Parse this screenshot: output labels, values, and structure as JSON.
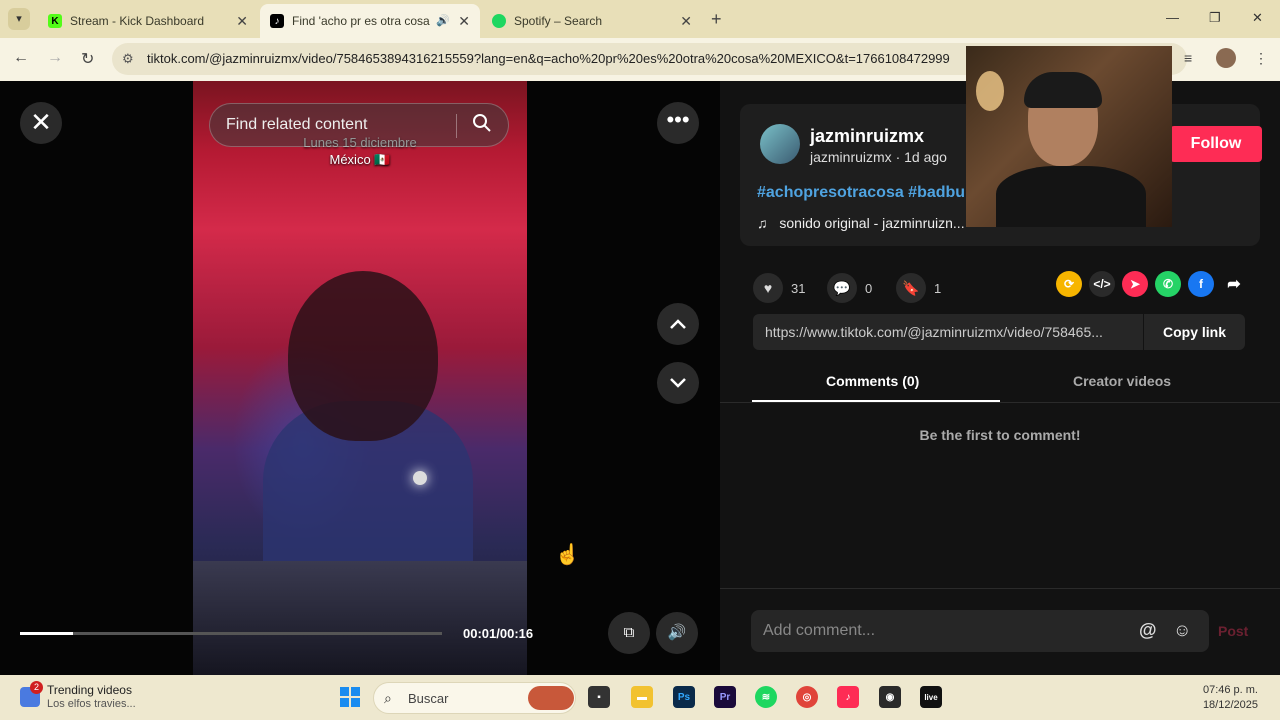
{
  "browser": {
    "tabs": [
      {
        "title": "Stream - Kick Dashboard",
        "icon": "kick-icon"
      },
      {
        "title": "Find 'acho pr es otra cosa M",
        "icon": "tiktok-icon"
      },
      {
        "title": "Spotify – Search",
        "icon": "spotify-icon"
      }
    ],
    "url": "tiktok.com/@jazminruizmx/video/7584653894316215559?lang=en&q=acho%20pr%20es%20otra%20cosa%20MEXICO&t=1766108472999"
  },
  "viewer": {
    "search_placeholder": "Find related content",
    "overlay_line1": "Lunes 15 diciembre",
    "overlay_line2": "México 🇲🇽",
    "time": "00:01/00:16",
    "progress_fraction": 0.125
  },
  "panel": {
    "username": "jazminruizmx",
    "subline": "jazminruizmx · 1d ago",
    "follow_label": "Follow",
    "hashtags": "#achopresotracosa #badbu",
    "sound": "sonido original - jazminruizn...",
    "likes": "31",
    "comments": "0",
    "saves": "1",
    "link": "https://www.tiktok.com/@jazminruizmx/video/758465...",
    "copy_label": "Copy link",
    "tab_comments": "Comments (0)",
    "tab_creator": "Creator videos",
    "empty_text": "Be the first to comment!",
    "comment_placeholder": "Add comment...",
    "post_label": "Post"
  },
  "taskbar": {
    "widget_title": "Trending videos",
    "widget_sub": "Los elfos travies...",
    "widget_badge": "2",
    "search_placeholder": "Buscar",
    "time": "07:46 p. m.",
    "date": "18/12/2025"
  },
  "colors": {
    "accent": "#fe2c55",
    "hashtag": "#4fa3e0"
  }
}
